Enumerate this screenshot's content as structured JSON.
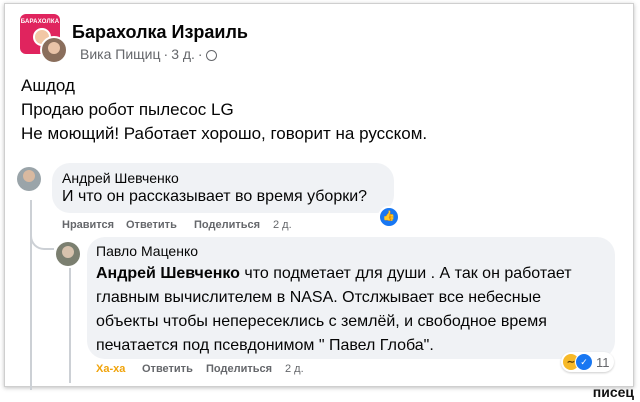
{
  "post": {
    "group_name": "Барахолка Израиль",
    "logo_text": "БАРАХОЛКА",
    "author": "Вика Пищиц",
    "time": "3 д.",
    "lines": [
      "Ашдод",
      "Продаю робот пылесос LG",
      "Не моющий! Работает хорошо, говорит на русском."
    ]
  },
  "comment1": {
    "name": "Андрей Шевченко",
    "text": "И что он рассказывает во время уборки?",
    "like_label": "Нравится",
    "reply_label": "Ответить",
    "share_label": "Поделиться",
    "time": "2 д."
  },
  "comment2": {
    "name": "Павло Маценко",
    "mention": "Андрей Шевченко",
    "text_lines": [
      " что подметает для души . А так он работает",
      "главным вычислителем в NASA. Отслжывает все небесные",
      "объекты чтобы непересеклись с землёй, и свободное время",
      "печатается под псевдонимом \" Павел Глоба\"."
    ],
    "haha_label": "Ха-ха",
    "reply_label": "Ответить",
    "share_label": "Поделиться",
    "time": "2 д.",
    "reaction_count": "11"
  },
  "watermark": "писец",
  "colors": {
    "accent": "#1877f2",
    "bubble": "#f0f2f5",
    "haha": "#f7b928"
  }
}
